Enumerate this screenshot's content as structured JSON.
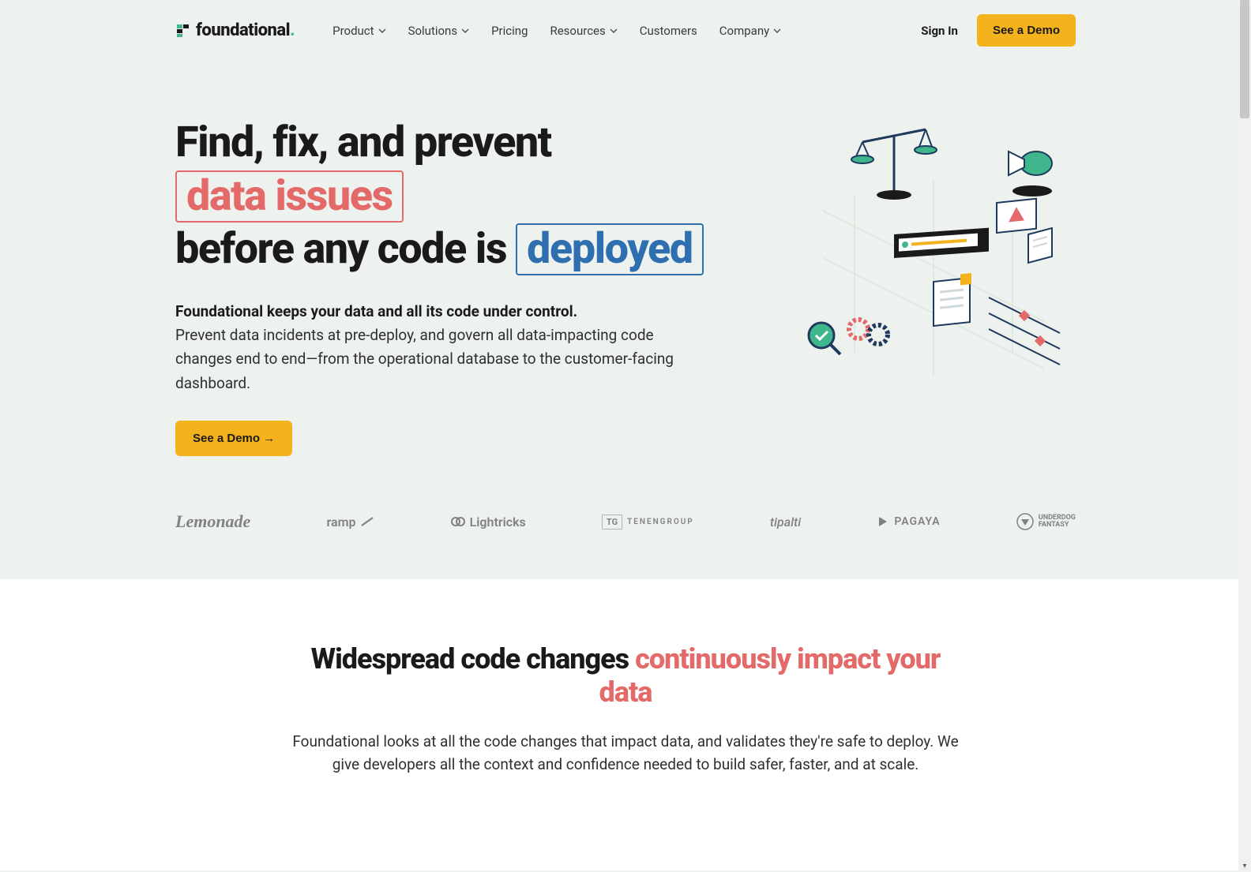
{
  "brand": {
    "name": "foundational",
    "dot": "."
  },
  "nav": {
    "items": [
      {
        "label": "Product",
        "dropdown": true
      },
      {
        "label": "Solutions",
        "dropdown": true
      },
      {
        "label": "Pricing",
        "dropdown": false
      },
      {
        "label": "Resources",
        "dropdown": true
      },
      {
        "label": "Customers",
        "dropdown": false
      },
      {
        "label": "Company",
        "dropdown": true
      }
    ],
    "signin": "Sign In",
    "cta": "See a Demo"
  },
  "hero": {
    "h1_part1": "Find, fix, and prevent ",
    "h1_highlight1": "data issues",
    "h1_part2": "before any code is ",
    "h1_highlight2": "deployed",
    "sub_bold": "Foundational keeps your data and all its code under control.",
    "sub_body": "Prevent data incidents at pre-deploy, and govern all data-impacting code changes end to end—from the operational database to the customer-facing dashboard.",
    "cta": "See a Demo →"
  },
  "customers": [
    "Lemonade",
    "ramp",
    "Lightricks",
    "TENENGROUP",
    "tipalti",
    "PAGAYA",
    "UNDERDOG FANTASY"
  ],
  "section2": {
    "h2_part1": "Widespread code changes ",
    "h2_pink": "continuously impact your data",
    "body": "Foundational looks at all the code changes that impact data, and validates they're safe to deploy. We give developers all the context and confidence needed to build safer, faster, and at scale."
  }
}
